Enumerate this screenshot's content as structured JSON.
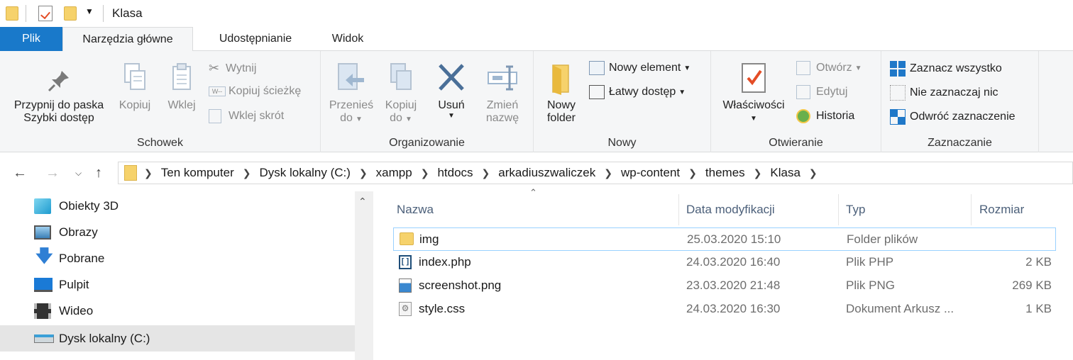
{
  "window": {
    "title": "Klasa"
  },
  "tabs": [
    {
      "label": "Plik"
    },
    {
      "label": "Narzędzia główne"
    },
    {
      "label": "Udostępnianie"
    },
    {
      "label": "Widok"
    }
  ],
  "ribbon": {
    "clipboard": {
      "label": "Schowek",
      "pin_line1": "Przypnij do paska",
      "pin_line2": "Szybki dostęp",
      "copy": "Kopiuj",
      "paste": "Wklej",
      "cut": "Wytnij",
      "copy_path": "Kopiuj ścieżkę",
      "paste_shortcut": "Wklej skrót"
    },
    "organize": {
      "label": "Organizowanie",
      "move_line1": "Przenieś",
      "move_line2": "do",
      "copy_line1": "Kopiuj",
      "copy_line2": "do",
      "delete": "Usuń",
      "rename_line1": "Zmień",
      "rename_line2": "nazwę"
    },
    "new": {
      "label": "Nowy",
      "folder_line1": "Nowy",
      "folder_line2": "folder",
      "new_item": "Nowy element",
      "easy_access": "Łatwy dostęp"
    },
    "open": {
      "label": "Otwieranie",
      "properties": "Właściwości",
      "open": "Otwórz",
      "edit": "Edytuj",
      "history": "Historia"
    },
    "select": {
      "label": "Zaznaczanie",
      "select_all": "Zaznacz wszystko",
      "select_none": "Nie zaznaczaj nic",
      "invert": "Odwróć zaznaczenie"
    }
  },
  "address": {
    "crumbs": [
      "Ten komputer",
      "Dysk lokalny (C:)",
      "xampp",
      "htdocs",
      "arkadiuszwaliczek",
      "wp-content",
      "themes",
      "Klasa"
    ]
  },
  "navpane": {
    "items": [
      {
        "label": "Obiekty 3D",
        "icon": "cube-3d-icon"
      },
      {
        "label": "Obrazy",
        "icon": "pictures-icon"
      },
      {
        "label": "Pobrane",
        "icon": "download-icon"
      },
      {
        "label": "Pulpit",
        "icon": "desktop-icon"
      },
      {
        "label": "Wideo",
        "icon": "video-icon"
      },
      {
        "label": "Dysk lokalny (C:)",
        "icon": "drive-icon",
        "selected": true
      }
    ]
  },
  "columns": {
    "name": "Nazwa",
    "date": "Data modyfikacji",
    "type": "Typ",
    "size": "Rozmiar"
  },
  "files": [
    {
      "name": "img",
      "date": "25.03.2020 15:10",
      "type": "Folder plików",
      "size": "",
      "icon": "folder-icon"
    },
    {
      "name": "index.php",
      "date": "24.03.2020 16:40",
      "type": "Plik PHP",
      "size": "2 KB",
      "icon": "php-file-icon"
    },
    {
      "name": "screenshot.png",
      "date": "23.03.2020 21:48",
      "type": "Plik PNG",
      "size": "269 KB",
      "icon": "image-file-icon"
    },
    {
      "name": "style.css",
      "date": "24.03.2020 16:30",
      "type": "Dokument Arkusz ...",
      "size": "1 KB",
      "icon": "css-file-icon"
    }
  ],
  "colors": {
    "accent": "#1979ca",
    "selection": "#e5e5e5",
    "header_text": "#4c607a"
  }
}
